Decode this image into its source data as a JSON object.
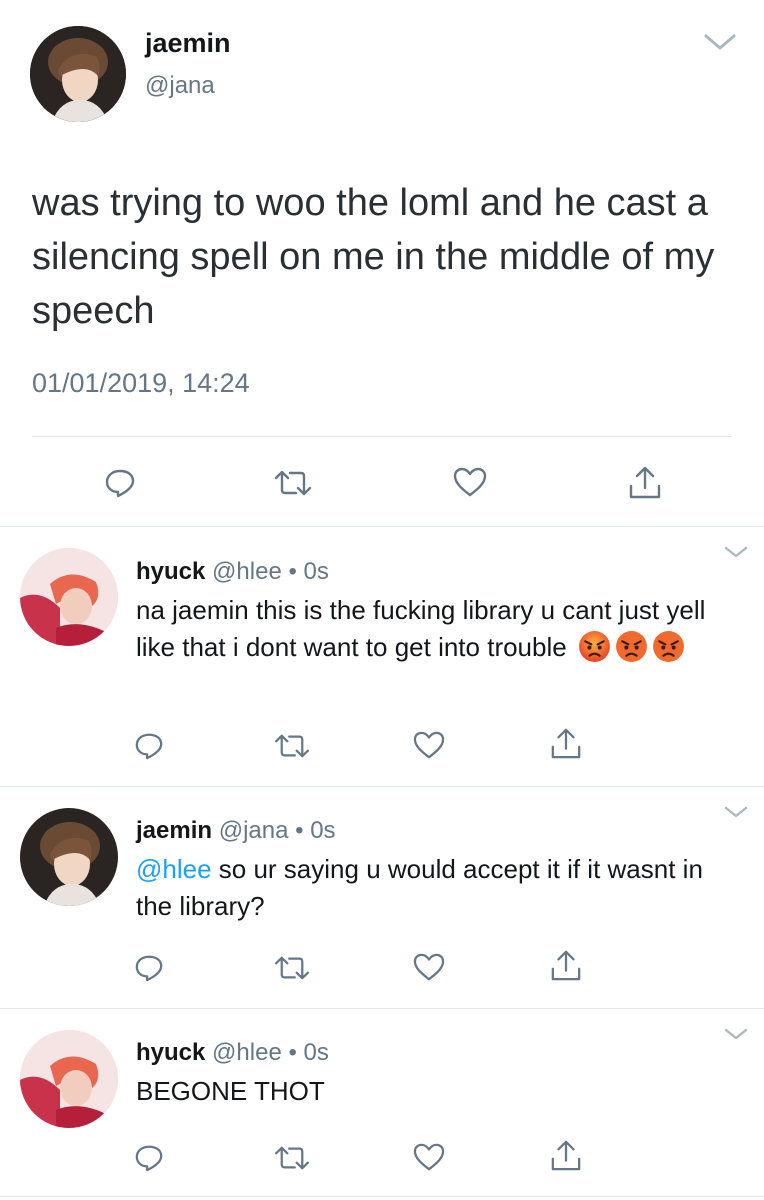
{
  "main_tweet": {
    "name": "jaemin",
    "handle": "@jana",
    "text": "was trying to woo the loml and he cast a silencing spell on me in the middle of my speech",
    "timestamp": "01/01/2019, 14:24"
  },
  "replies": [
    {
      "name": "hyuck",
      "handle": "@hlee",
      "separator": "•",
      "time": "0s",
      "text": "na jaemin this is the fucking library u cant just yell like that i dont want to get into trouble",
      "emoji": [
        "angry-face",
        "angry-face",
        "angry-face"
      ]
    },
    {
      "name": "jaemin",
      "handle": "@jana",
      "separator": "•",
      "time": "0s",
      "mention": "@hlee",
      "text": " so ur saying u would accept it if it wasnt in the library?"
    },
    {
      "name": "hyuck",
      "handle": "@hlee",
      "separator": "•",
      "time": "0s",
      "text": "BEGONE THOT"
    }
  ],
  "action_icons": [
    "reply-icon",
    "retweet-icon",
    "like-icon",
    "share-icon"
  ],
  "colors": {
    "text": "#14171a",
    "secondary": "#657786",
    "mention": "#1da1f2",
    "divider": "#e1e8ed",
    "icon": "#657786"
  }
}
